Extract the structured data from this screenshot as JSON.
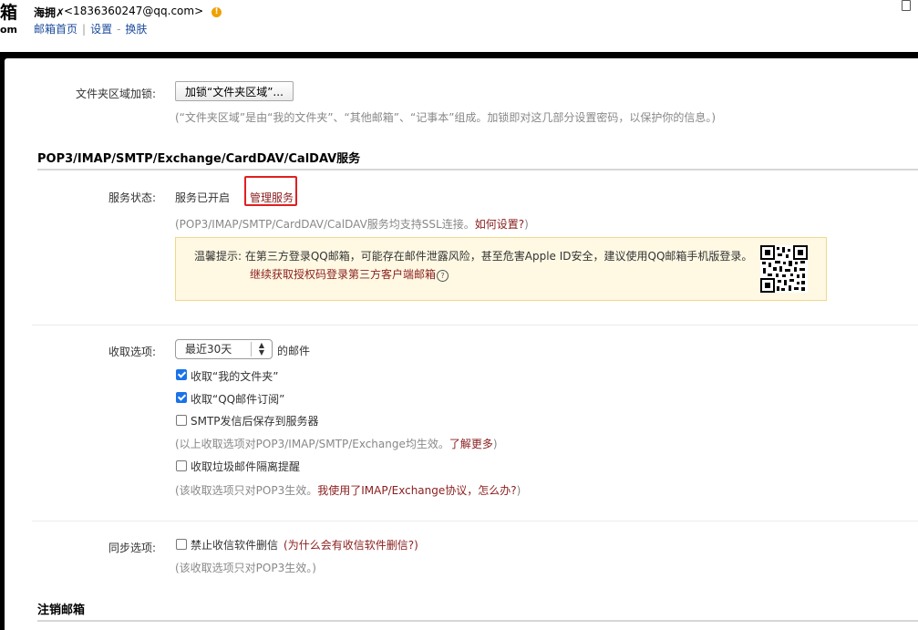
{
  "header": {
    "logo_chars": "箱",
    "logo_sub": "om",
    "user_name": "海拥✗",
    "user_email": "<1836360247@qq.com>",
    "warn_icon": "!",
    "links": [
      "邮箱首页",
      "设置",
      "换肤"
    ],
    "sep1": "|",
    "sep2": "-"
  },
  "folder_lock": {
    "label": "文件夹区域加锁:",
    "button": "加锁“文件夹区域”...",
    "note": "(“文件夹区域”是由“我的文件夹”、“其他邮箱”、“记事本”组成。加锁即对这几部分设置密码，以保护你的信息。)"
  },
  "services": {
    "title": "POP3/IMAP/SMTP/Exchange/CardDAV/CalDAV服务",
    "status_label": "服务状态:",
    "status_value": "服务已开启",
    "manage_link": "管理服务",
    "ssl_note_prefix": "(POP3/IMAP/SMTP/CardDAV/CalDAV服务均支持SSL连接。",
    "ssl_note_link": "如何设置?",
    "ssl_note_suffix": ")",
    "tip_line1": "温馨提示:  在第三方登录QQ邮箱，可能存在邮件泄露风险，甚至危害Apple ID安全，建议使用QQ邮箱手机版登录。",
    "tip_line2": "继续获取授权码登录第三方客户端邮箱",
    "tip_help": "?"
  },
  "receive": {
    "label": "收取选项:",
    "select_value": "最近30天",
    "select_suffix": "的邮件",
    "options": [
      {
        "label": "收取“我的文件夹”",
        "checked": true
      },
      {
        "label": "收取“QQ邮件订阅”",
        "checked": true
      },
      {
        "label": "SMTP发信后保存到服务器",
        "checked": false
      }
    ],
    "note1_prefix": "(以上收取选项对POP3/IMAP/SMTP/Exchange均生效。",
    "note1_link": "了解更多",
    "note1_suffix": ")",
    "spam_option": "收取垃圾邮件隔离提醒",
    "spam_checked": false,
    "note2_prefix": "(该收取选项只对POP3生效。",
    "note2_link": "我使用了IMAP/Exchange协议，怎么办?",
    "note2_suffix": ")"
  },
  "sync": {
    "label": "同步选项:",
    "option": "禁止收信软件删信",
    "option_link": "(为什么会有收信软件删信?)",
    "checked": false,
    "note": "(该收取选项只对POP3生效。)"
  },
  "cancel": {
    "title": "注销邮箱"
  },
  "colors": {
    "link": "#8a1d1d",
    "accent_red": "#e02020",
    "checkbox": "#1a73e8",
    "tip_bg": "#fff9e3"
  }
}
